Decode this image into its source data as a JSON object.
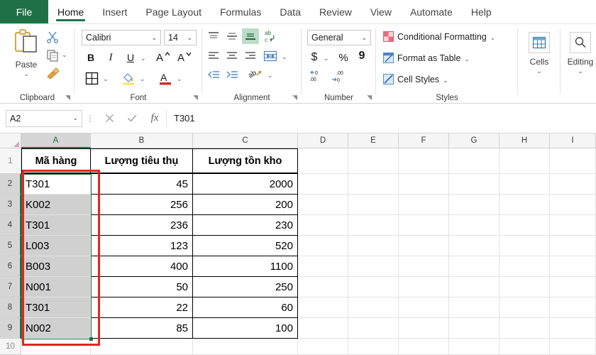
{
  "window": {
    "app": "Microsoft Excel"
  },
  "ribbon_tabs": {
    "file": "File",
    "items": [
      "Home",
      "Insert",
      "Page Layout",
      "Formulas",
      "Data",
      "Review",
      "View",
      "Automate",
      "Help"
    ],
    "active": "Home"
  },
  "ribbon": {
    "groups": [
      "Clipboard",
      "Font",
      "Alignment",
      "Number",
      "Styles",
      "Cells",
      "Editing"
    ],
    "clipboard": {
      "label": "Clipboard",
      "paste": "Paste",
      "paste_caret": "⌄",
      "cut_icon": "scissors-icon",
      "copy_icon": "copy-icon",
      "format_painter_icon": "format-painter-icon"
    },
    "font": {
      "label": "Font",
      "family": "Calibri",
      "size": "14",
      "bold": "B",
      "italic": "I",
      "underline": "U",
      "grow": "A",
      "shrink": "A",
      "borders_icon": "borders-icon",
      "fill_icon": "fill-color-icon",
      "font_color_icon": "font-color-icon"
    },
    "alignment": {
      "label": "Alignment",
      "top_align_icon": "align-top-icon",
      "middle_align_icon": "align-middle-icon",
      "bottom_align_icon": "align-bottom-icon",
      "wrap_text_icon": "wrap-text-icon",
      "align_left_icon": "align-left-icon",
      "align_center_icon": "align-center-icon",
      "align_right_icon": "align-right-icon",
      "merge_icon": "merge-center-icon",
      "decrease_indent_icon": "decrease-indent-icon",
      "increase_indent_icon": "increase-indent-icon",
      "orientation_icon": "orientation-icon"
    },
    "number": {
      "label": "Number",
      "format": "General",
      "currency": "$",
      "percent": "%",
      "comma": "9",
      "decrease_decimal": ".00",
      "increase_decimal": ".0"
    },
    "styles": {
      "label": "Styles",
      "items": [
        "Conditional Formatting",
        "Format as Table",
        "Cell Styles"
      ]
    },
    "cells": {
      "label": "Cells",
      "caret": "⌄"
    },
    "editing": {
      "label": "Editing",
      "caret": "⌄"
    }
  },
  "formula_bar": {
    "name_box": "A2",
    "name_box_caret": "⌄",
    "cancel_icon": "cancel-icon",
    "enter_icon": "confirm-icon",
    "function_icon": "fx",
    "formula_value": "T301"
  },
  "sheet": {
    "column_headers": [
      "A",
      "B",
      "C",
      "D",
      "E",
      "F",
      "G",
      "H",
      "I"
    ],
    "selected_column": "A",
    "row_headers": [
      "1",
      "2",
      "3",
      "4",
      "5",
      "6",
      "7",
      "8",
      "9",
      "10"
    ],
    "selected_rows": [
      "2",
      "3",
      "4",
      "5",
      "6",
      "7",
      "8",
      "9"
    ],
    "table_headers": [
      "Mã hàng",
      "Lượng tiêu thụ",
      "Lượng tồn kho"
    ],
    "rows": [
      {
        "code": "T301",
        "consumed": "45",
        "stock": "2000"
      },
      {
        "code": "K002",
        "consumed": "256",
        "stock": "200"
      },
      {
        "code": "T301",
        "consumed": "236",
        "stock": "230"
      },
      {
        "code": "L003",
        "consumed": "123",
        "stock": "520"
      },
      {
        "code": "B003",
        "consumed": "400",
        "stock": "1100"
      },
      {
        "code": "N001",
        "consumed": "50",
        "stock": "250"
      },
      {
        "code": "T301",
        "consumed": "22",
        "stock": "60"
      },
      {
        "code": "N002",
        "consumed": "85",
        "stock": "100"
      }
    ],
    "selection_range": "A2:A9",
    "annotation": {
      "name": "red-highlight-box",
      "color": "#e8231f"
    }
  },
  "colors": {
    "excel_green": "#217346",
    "file_tab_green": "#1e7145",
    "selection_green": "#217346",
    "annotation_red": "#e8231f",
    "header_gray": "#f5f5f5",
    "selected_cell_gray": "#d0d0d0"
  }
}
